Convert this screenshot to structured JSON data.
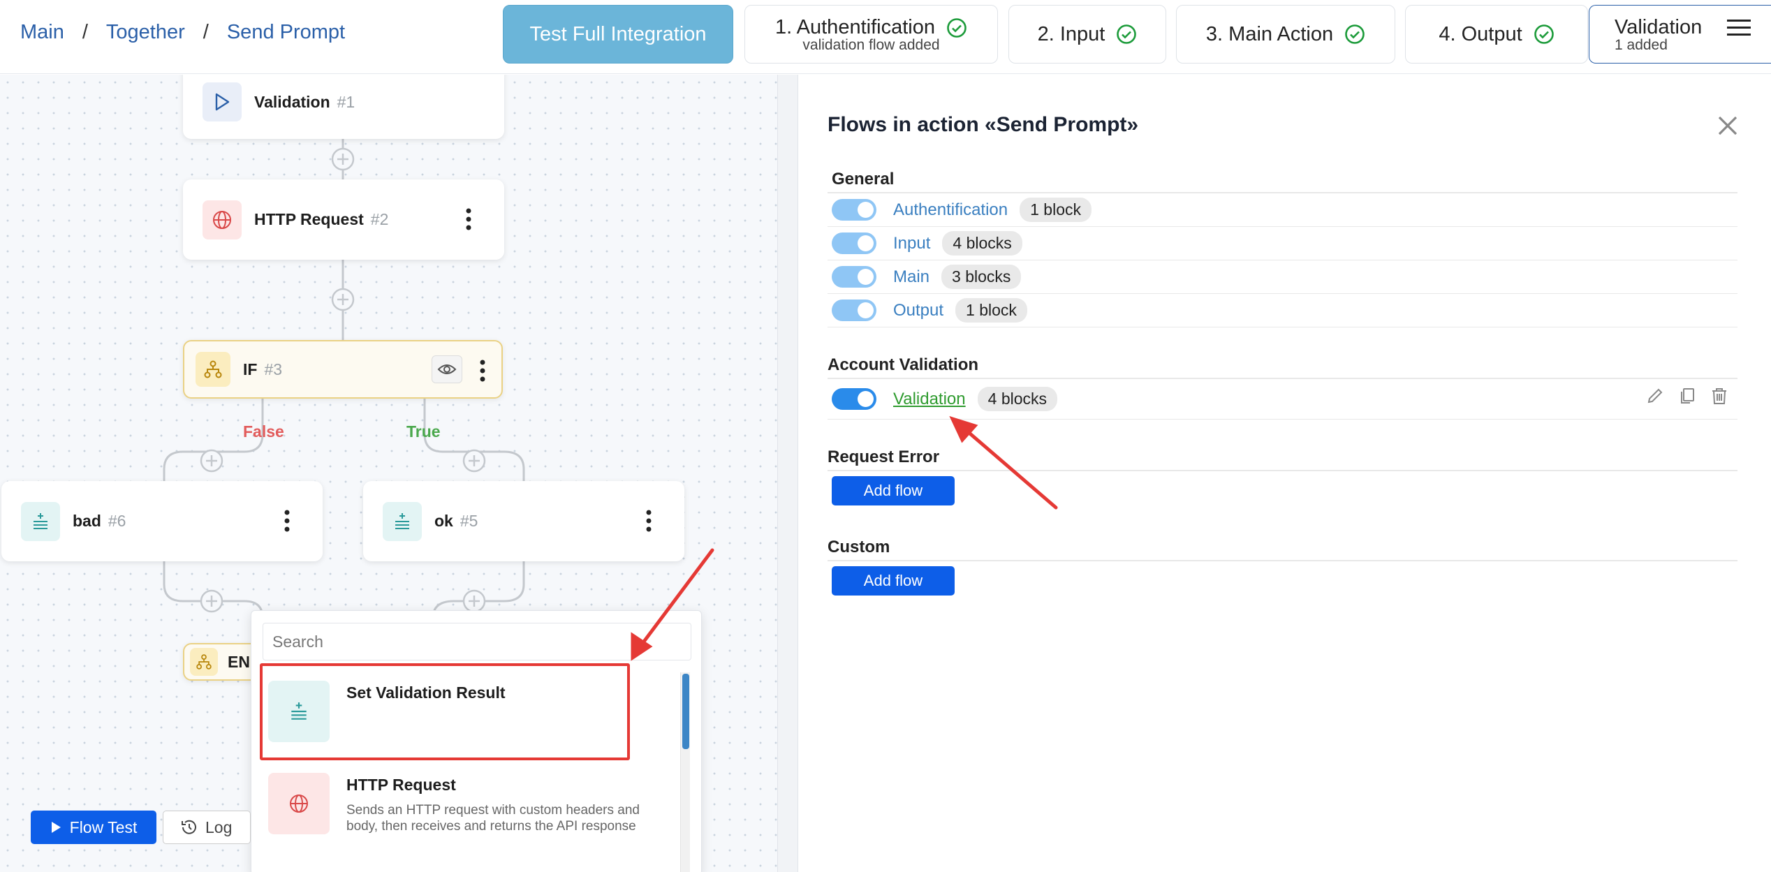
{
  "breadcrumb": {
    "items": [
      "Main",
      "Together",
      "Send Prompt"
    ],
    "separator": "/"
  },
  "header": {
    "test_button": "Test Full Integration",
    "steps": [
      {
        "label": "1. Authentification",
        "sub": "validation flow added"
      },
      {
        "label": "2. Input"
      },
      {
        "label": "3. Main Action"
      },
      {
        "label": "4. Output"
      },
      {
        "label": "Validation",
        "sub": "1 added"
      }
    ]
  },
  "canvas": {
    "nodes": {
      "validation": {
        "name": "Validation",
        "num": "#1"
      },
      "http": {
        "name": "HTTP Request",
        "num": "#2"
      },
      "if": {
        "name": "IF",
        "num": "#3"
      },
      "bad": {
        "name": "bad",
        "num": "#6"
      },
      "ok": {
        "name": "ok",
        "num": "#5"
      },
      "end": {
        "name": "EN"
      }
    },
    "branch_false": "False",
    "branch_true": "True",
    "flow_test": "Flow Test",
    "log": "Log"
  },
  "popup": {
    "search_placeholder": "Search",
    "items": [
      {
        "title": "Set Validation Result",
        "desc": ""
      },
      {
        "title": "HTTP Request",
        "desc": "Sends an HTTP request with custom headers and body, then receives and returns the API response"
      }
    ]
  },
  "panel": {
    "title": "Flows in action «Send Prompt»",
    "sections": {
      "general": {
        "title": "General",
        "rows": [
          {
            "name": "Authentification",
            "count": "1 block"
          },
          {
            "name": "Input",
            "count": "4 blocks"
          },
          {
            "name": "Main",
            "count": "3 blocks"
          },
          {
            "name": "Output",
            "count": "1 block"
          }
        ]
      },
      "account_validation": {
        "title": "Account Validation",
        "rows": [
          {
            "name": "Validation",
            "count": "4 blocks"
          }
        ]
      },
      "request_error": {
        "title": "Request Error",
        "button": "Add flow"
      },
      "custom": {
        "title": "Custom",
        "button": "Add flow"
      }
    }
  },
  "colors": {
    "accent": "#0d5ee8",
    "highlight": "#e53935",
    "link": "#3a7fc0",
    "success": "#2f9b2f"
  }
}
